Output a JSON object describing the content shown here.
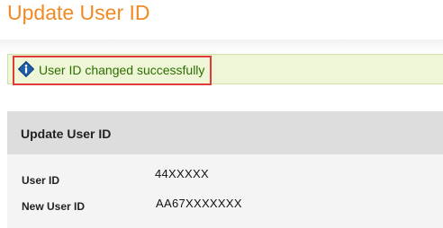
{
  "page": {
    "title": "Update User ID"
  },
  "alert": {
    "message": "User ID changed successfully",
    "icon": "info-diamond-icon"
  },
  "panel": {
    "title": "Update User ID",
    "fields": [
      {
        "label": "User ID",
        "value": "44XXXXX"
      },
      {
        "label": "New User ID",
        "value": "AA67XXXXXXX"
      }
    ]
  },
  "colors": {
    "title_orange": "#f08a24",
    "alert_background": "#eef6d7",
    "alert_text": "#2d6e00",
    "highlight_border": "#e03a3a",
    "panel_header": "#dddddd"
  }
}
